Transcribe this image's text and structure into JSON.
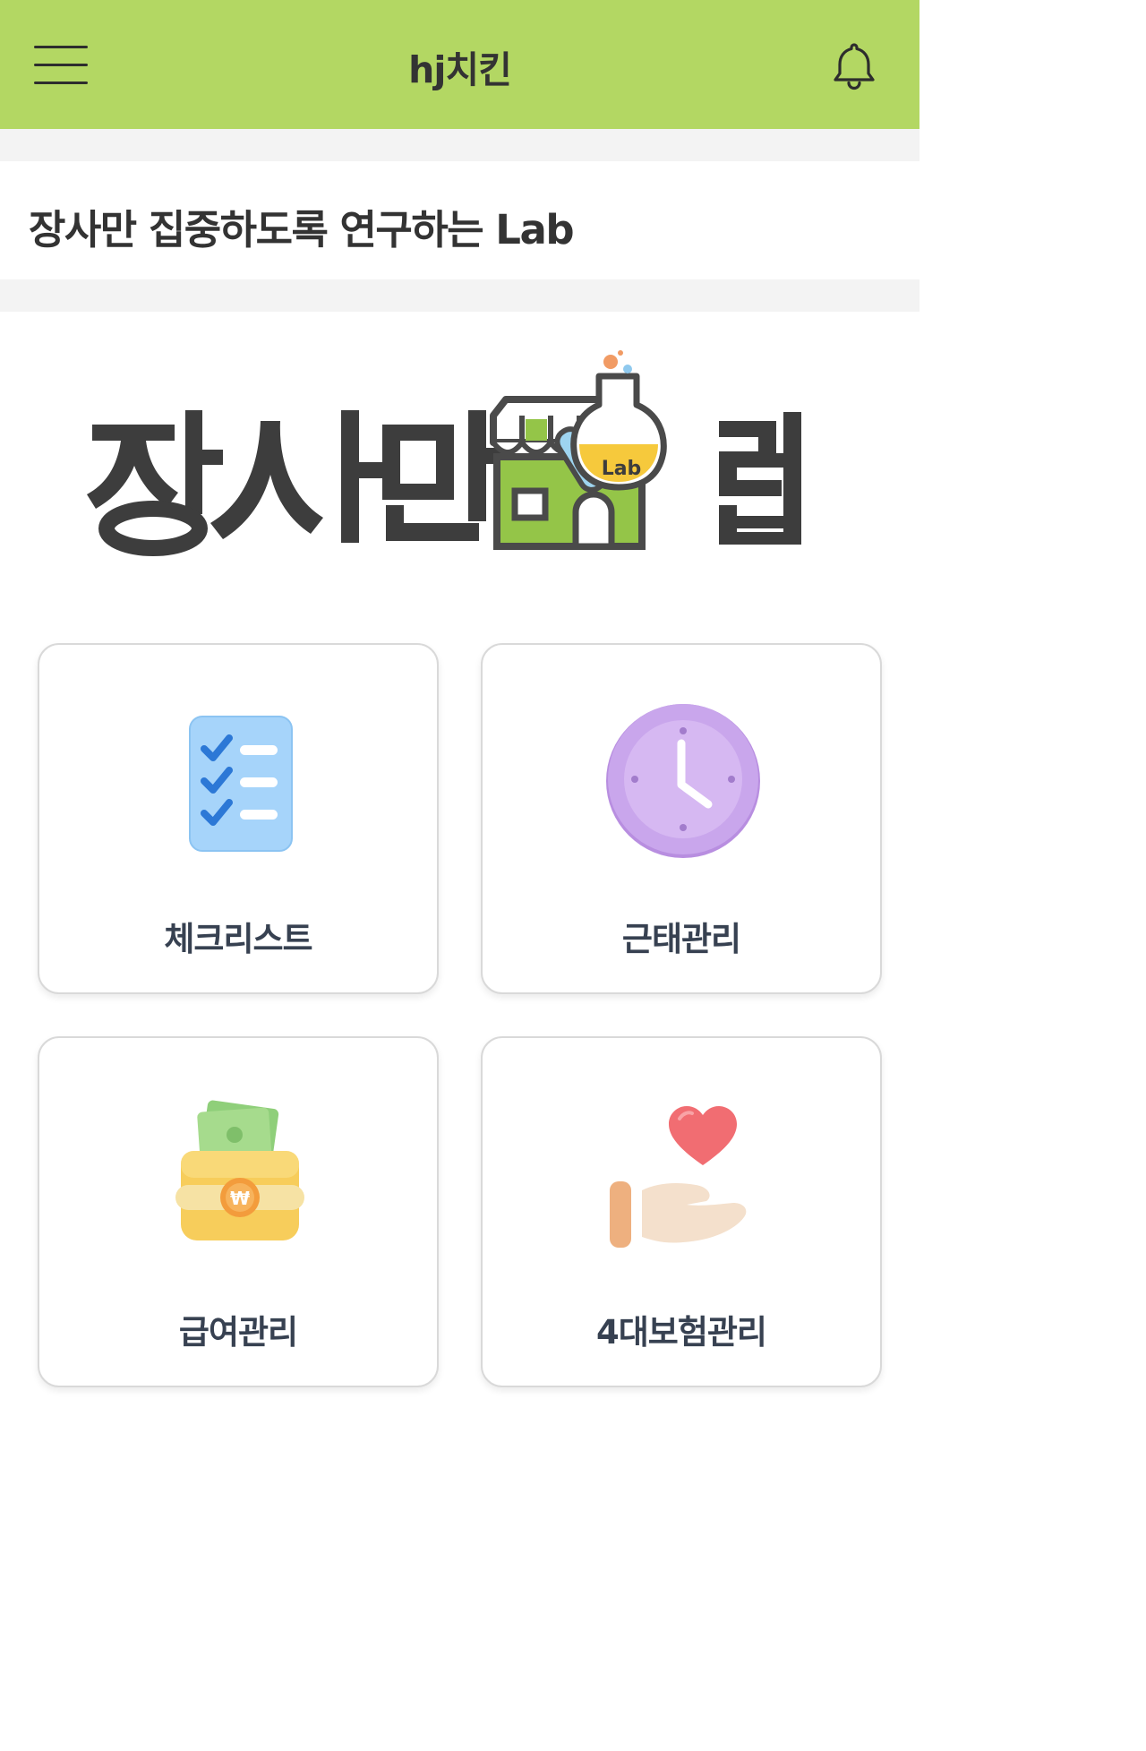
{
  "header": {
    "title": "hj치킨",
    "menu_icon": "hamburger-menu-icon",
    "notification_icon": "bell-icon",
    "background_color": "#b3d763"
  },
  "tagline": "장사만 집중하도록 연구하는 Lab",
  "logo": {
    "text": "장사만 랩",
    "badge_text": "Lab",
    "icon": "storefront-flask-logo",
    "colors": {
      "text": "#3d3d3d",
      "green": "#94c548",
      "yellow": "#f6c93c",
      "outline": "#4a4a4a"
    }
  },
  "menu_cards": [
    {
      "label": "체크리스트",
      "icon": "checklist-icon",
      "color": "#a6d4fa"
    },
    {
      "label": "근태관리",
      "icon": "clock-icon",
      "color": "#c9a6ec"
    },
    {
      "label": "급여관리",
      "icon": "wallet-money-icon",
      "color": "#f7cd5b"
    },
    {
      "label": "4대보험관리",
      "icon": "heart-hand-icon",
      "color": "#f16d72"
    }
  ]
}
